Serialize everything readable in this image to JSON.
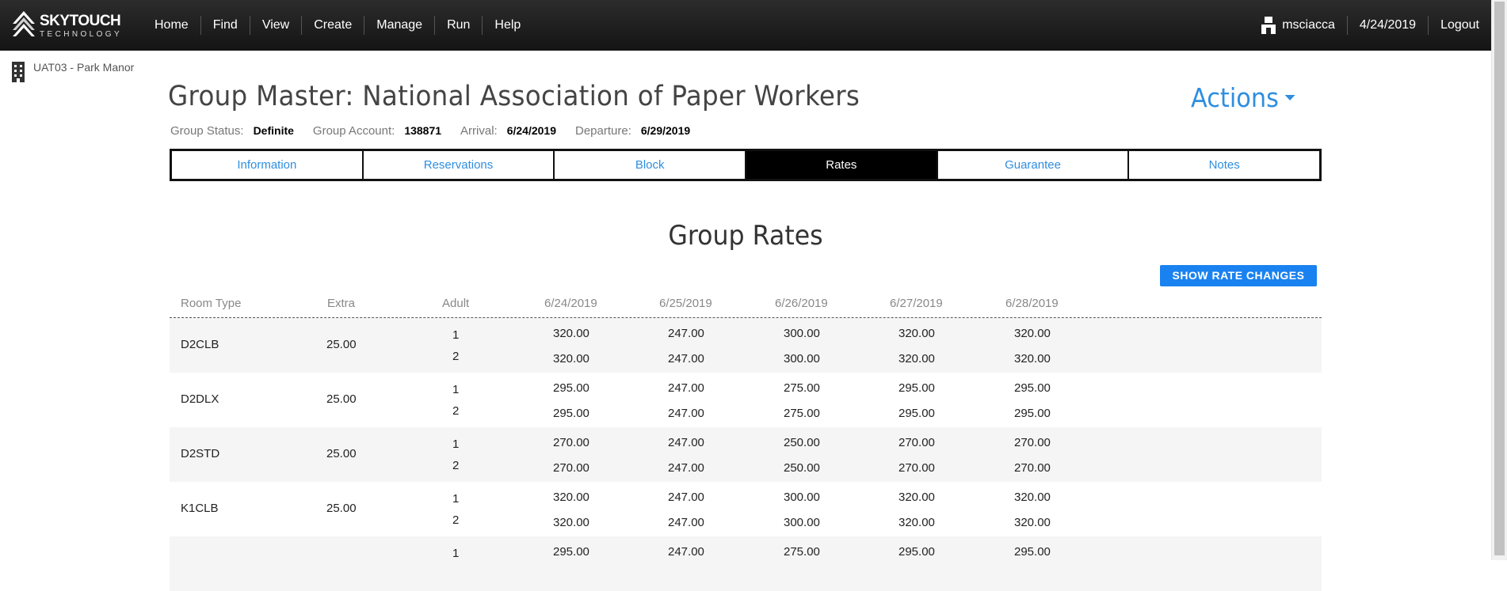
{
  "brand": {
    "name": "SKYTOUCH",
    "tagline": "TECHNOLOGY"
  },
  "nav": {
    "items": [
      "Home",
      "Find",
      "View",
      "Create",
      "Manage",
      "Run",
      "Help"
    ]
  },
  "user": {
    "name": "msciacca",
    "date": "4/24/2019",
    "logout": "Logout"
  },
  "property": {
    "label": "UAT03 - Park Manor"
  },
  "page": {
    "title": "Group Master: National Association of Paper Workers",
    "actions_label": "Actions"
  },
  "status": {
    "status_label": "Group Status:",
    "status_value": "Definite",
    "account_label": "Group Account:",
    "account_value": "138871",
    "arrival_label": "Arrival:",
    "arrival_value": "6/24/2019",
    "departure_label": "Departure:",
    "departure_value": "6/29/2019"
  },
  "tabs": [
    "Information",
    "Reservations",
    "Block",
    "Rates",
    "Guarantee",
    "Notes"
  ],
  "active_tab": "Rates",
  "rates": {
    "title": "Group Rates",
    "show_changes_label": "SHOW RATE CHANGES",
    "columns": [
      "Room Type",
      "Extra",
      "Adult",
      "6/24/2019",
      "6/25/2019",
      "6/26/2019",
      "6/27/2019",
      "6/28/2019"
    ],
    "rows": [
      {
        "room_type": "D2CLB",
        "extra": "25.00",
        "lines": [
          {
            "adult": "1",
            "rates": [
              "320.00",
              "247.00",
              "300.00",
              "320.00",
              "320.00"
            ]
          },
          {
            "adult": "2",
            "rates": [
              "320.00",
              "247.00",
              "300.00",
              "320.00",
              "320.00"
            ]
          }
        ]
      },
      {
        "room_type": "D2DLX",
        "extra": "25.00",
        "lines": [
          {
            "adult": "1",
            "rates": [
              "295.00",
              "247.00",
              "275.00",
              "295.00",
              "295.00"
            ]
          },
          {
            "adult": "2",
            "rates": [
              "295.00",
              "247.00",
              "275.00",
              "295.00",
              "295.00"
            ]
          }
        ]
      },
      {
        "room_type": "D2STD",
        "extra": "25.00",
        "lines": [
          {
            "adult": "1",
            "rates": [
              "270.00",
              "247.00",
              "250.00",
              "270.00",
              "270.00"
            ]
          },
          {
            "adult": "2",
            "rates": [
              "270.00",
              "247.00",
              "250.00",
              "270.00",
              "270.00"
            ]
          }
        ]
      },
      {
        "room_type": "K1CLB",
        "extra": "25.00",
        "lines": [
          {
            "adult": "1",
            "rates": [
              "320.00",
              "247.00",
              "300.00",
              "320.00",
              "320.00"
            ]
          },
          {
            "adult": "2",
            "rates": [
              "320.00",
              "247.00",
              "300.00",
              "320.00",
              "320.00"
            ]
          }
        ]
      },
      {
        "room_type": "",
        "extra": "",
        "lines": [
          {
            "adult": "1",
            "rates": [
              "295.00",
              "247.00",
              "275.00",
              "295.00",
              "295.00"
            ]
          }
        ]
      }
    ]
  },
  "colors": {
    "topbar": "#1e1e1e",
    "link": "#2f8ee0",
    "button": "#1a82f0",
    "active_tab": "#000000",
    "row_alt": "#f5f5f5"
  },
  "icons": {
    "user": "user-icon",
    "building": "building-icon",
    "caret": "caret-down-icon",
    "logo": "skytouch-logo-icon"
  }
}
